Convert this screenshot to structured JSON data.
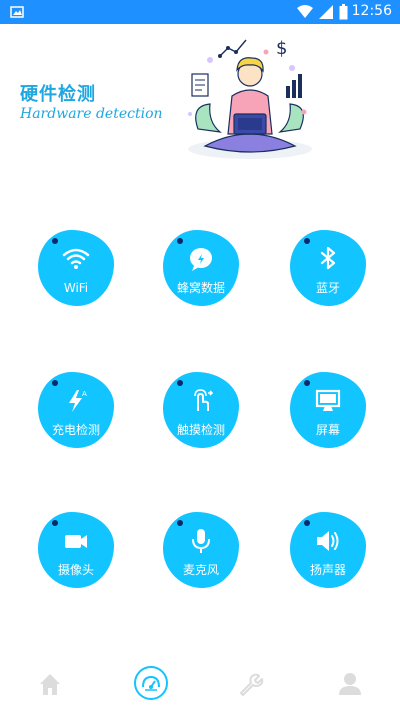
{
  "status_bar": {
    "time": "12:56"
  },
  "header": {
    "title": "硬件检测",
    "subtitle": "Hardware detection"
  },
  "tiles": [
    {
      "label": "WiFi",
      "icon": "wifi-icon"
    },
    {
      "label": "蜂窝数据",
      "icon": "cellular-icon"
    },
    {
      "label": "蓝牙",
      "icon": "bluetooth-icon"
    },
    {
      "label": "充电检测",
      "icon": "charging-icon"
    },
    {
      "label": "触摸检测",
      "icon": "touch-icon"
    },
    {
      "label": "屏幕",
      "icon": "screen-icon"
    },
    {
      "label": "摄像头",
      "icon": "camera-icon"
    },
    {
      "label": "麦克风",
      "icon": "microphone-icon"
    },
    {
      "label": "扬声器",
      "icon": "speaker-icon"
    }
  ],
  "bottom_nav": [
    {
      "icon": "home-icon",
      "active": false
    },
    {
      "icon": "gauge-icon",
      "active": true
    },
    {
      "icon": "wrench-icon",
      "active": false
    },
    {
      "icon": "user-icon",
      "active": false
    }
  ],
  "colors": {
    "status_bar": "#1e90ff",
    "accent": "#12c4ff",
    "title": "#1ea7e1",
    "inactive_nav": "#dcdcdc"
  }
}
